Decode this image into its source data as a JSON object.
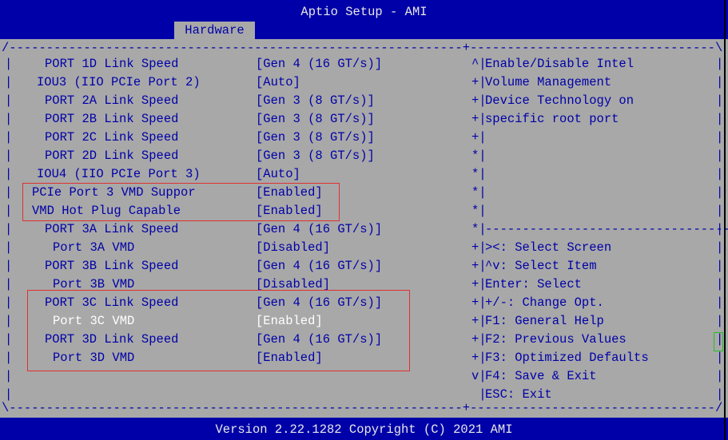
{
  "app": {
    "title": "Aptio Setup - AMI",
    "tab": "Hardware",
    "footer": "Version 2.22.1282 Copyright (C) 2021 AMI"
  },
  "settings": [
    {
      "label": "PORT 1D Link Speed",
      "value": "[Gen 4 (16 GT/s)]"
    },
    {
      "label": "IOU3 (IIO PCIe Port 2)",
      "value": "[Auto]"
    },
    {
      "label": "PORT 2A Link Speed",
      "value": "[Gen 3 (8 GT/s)]"
    },
    {
      "label": "PORT 2B Link Speed",
      "value": "[Gen 3 (8 GT/s)]"
    },
    {
      "label": "PORT 2C Link Speed",
      "value": "[Gen 3 (8 GT/s)]"
    },
    {
      "label": "PORT 2D Link Speed",
      "value": "[Gen 3 (8 GT/s)]"
    },
    {
      "label": "IOU4 (IIO PCIe Port 3)",
      "value": "[Auto]"
    },
    {
      "label": "PCIe Port 3 VMD Suppor",
      "value": "[Enabled]"
    },
    {
      "label": "VMD Hot Plug Capable",
      "value": "[Enabled]"
    },
    {
      "label": "PORT 3A Link Speed",
      "value": "[Gen 4 (16 GT/s)]"
    },
    {
      "label": "Port 3A VMD",
      "value": "[Disabled]"
    },
    {
      "label": "PORT 3B Link Speed",
      "value": "[Gen 4 (16 GT/s)]"
    },
    {
      "label": "Port 3B VMD",
      "value": "[Disabled]"
    },
    {
      "label": "PORT 3C Link Speed",
      "value": "[Gen 4 (16 GT/s)]"
    },
    {
      "label": "Port 3C VMD",
      "value": "[Enabled]",
      "highlighted": true
    },
    {
      "label": "PORT 3D Link Speed",
      "value": "[Gen 4 (16 GT/s)]"
    },
    {
      "label": "Port 3D VMD",
      "value": "[Enabled]"
    }
  ],
  "scroll_markers": [
    "^",
    "+",
    "+",
    "+",
    "+",
    "*",
    "*",
    "*",
    "*",
    "*",
    "+",
    "+",
    "+",
    "+",
    "+",
    "+",
    "+",
    "v"
  ],
  "help": {
    "description": [
      "Enable/Disable Intel",
      "Volume Management",
      "Device Technology on",
      "specific root port"
    ],
    "keys": [
      "><: Select Screen",
      "^v: Select Item",
      "Enter: Select",
      "+/-: Change Opt.",
      "F1: General Help",
      "F2: Previous Values",
      "F3: Optimized Defaults",
      "F4: Save & Exit",
      "ESC: Exit"
    ]
  },
  "colors": {
    "background_blue": "#0000a8",
    "panel_gray": "#a8a8a8",
    "highlight_text": "#ffffff",
    "annotation_red": "#e03030",
    "annotation_green": "#20c020"
  }
}
